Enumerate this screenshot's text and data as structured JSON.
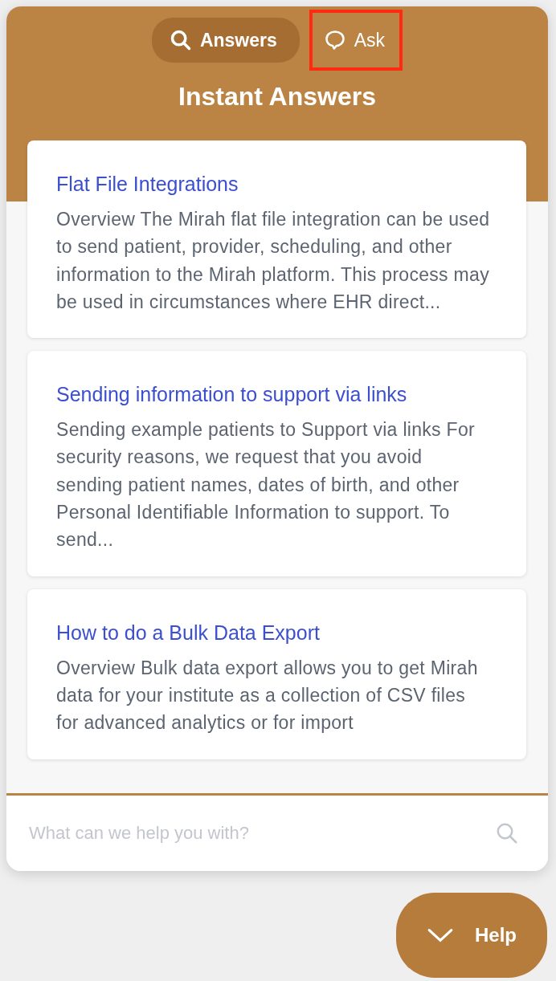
{
  "tabs": [
    {
      "label": "Answers",
      "kind": "search",
      "selected": true,
      "highlighted": false
    },
    {
      "label": "Ask",
      "kind": "chat",
      "selected": false,
      "highlighted": true
    }
  ],
  "title": "Instant Answers",
  "articles": [
    {
      "title": "Flat File Integrations",
      "excerpt": "Overview The Mirah flat file integration can be used to send patient, provider, scheduling, and other information to the Mirah platform. This process may be used in circumstances where EHR direct..."
    },
    {
      "title": "Sending information to support via links",
      "excerpt": "Sending example patients to Support via links For security reasons, we request that you avoid sending patient names, dates of birth, and other Personal Identifiable Information to support. To send..."
    },
    {
      "title": "How to do a Bulk Data Export",
      "excerpt": "Overview Bulk data export allows you to get Mirah data for your institute as a collection of CSV files for advanced analytics or for import"
    }
  ],
  "search": {
    "placeholder": "What can we help you with?"
  },
  "help_button": {
    "label": "Help"
  }
}
